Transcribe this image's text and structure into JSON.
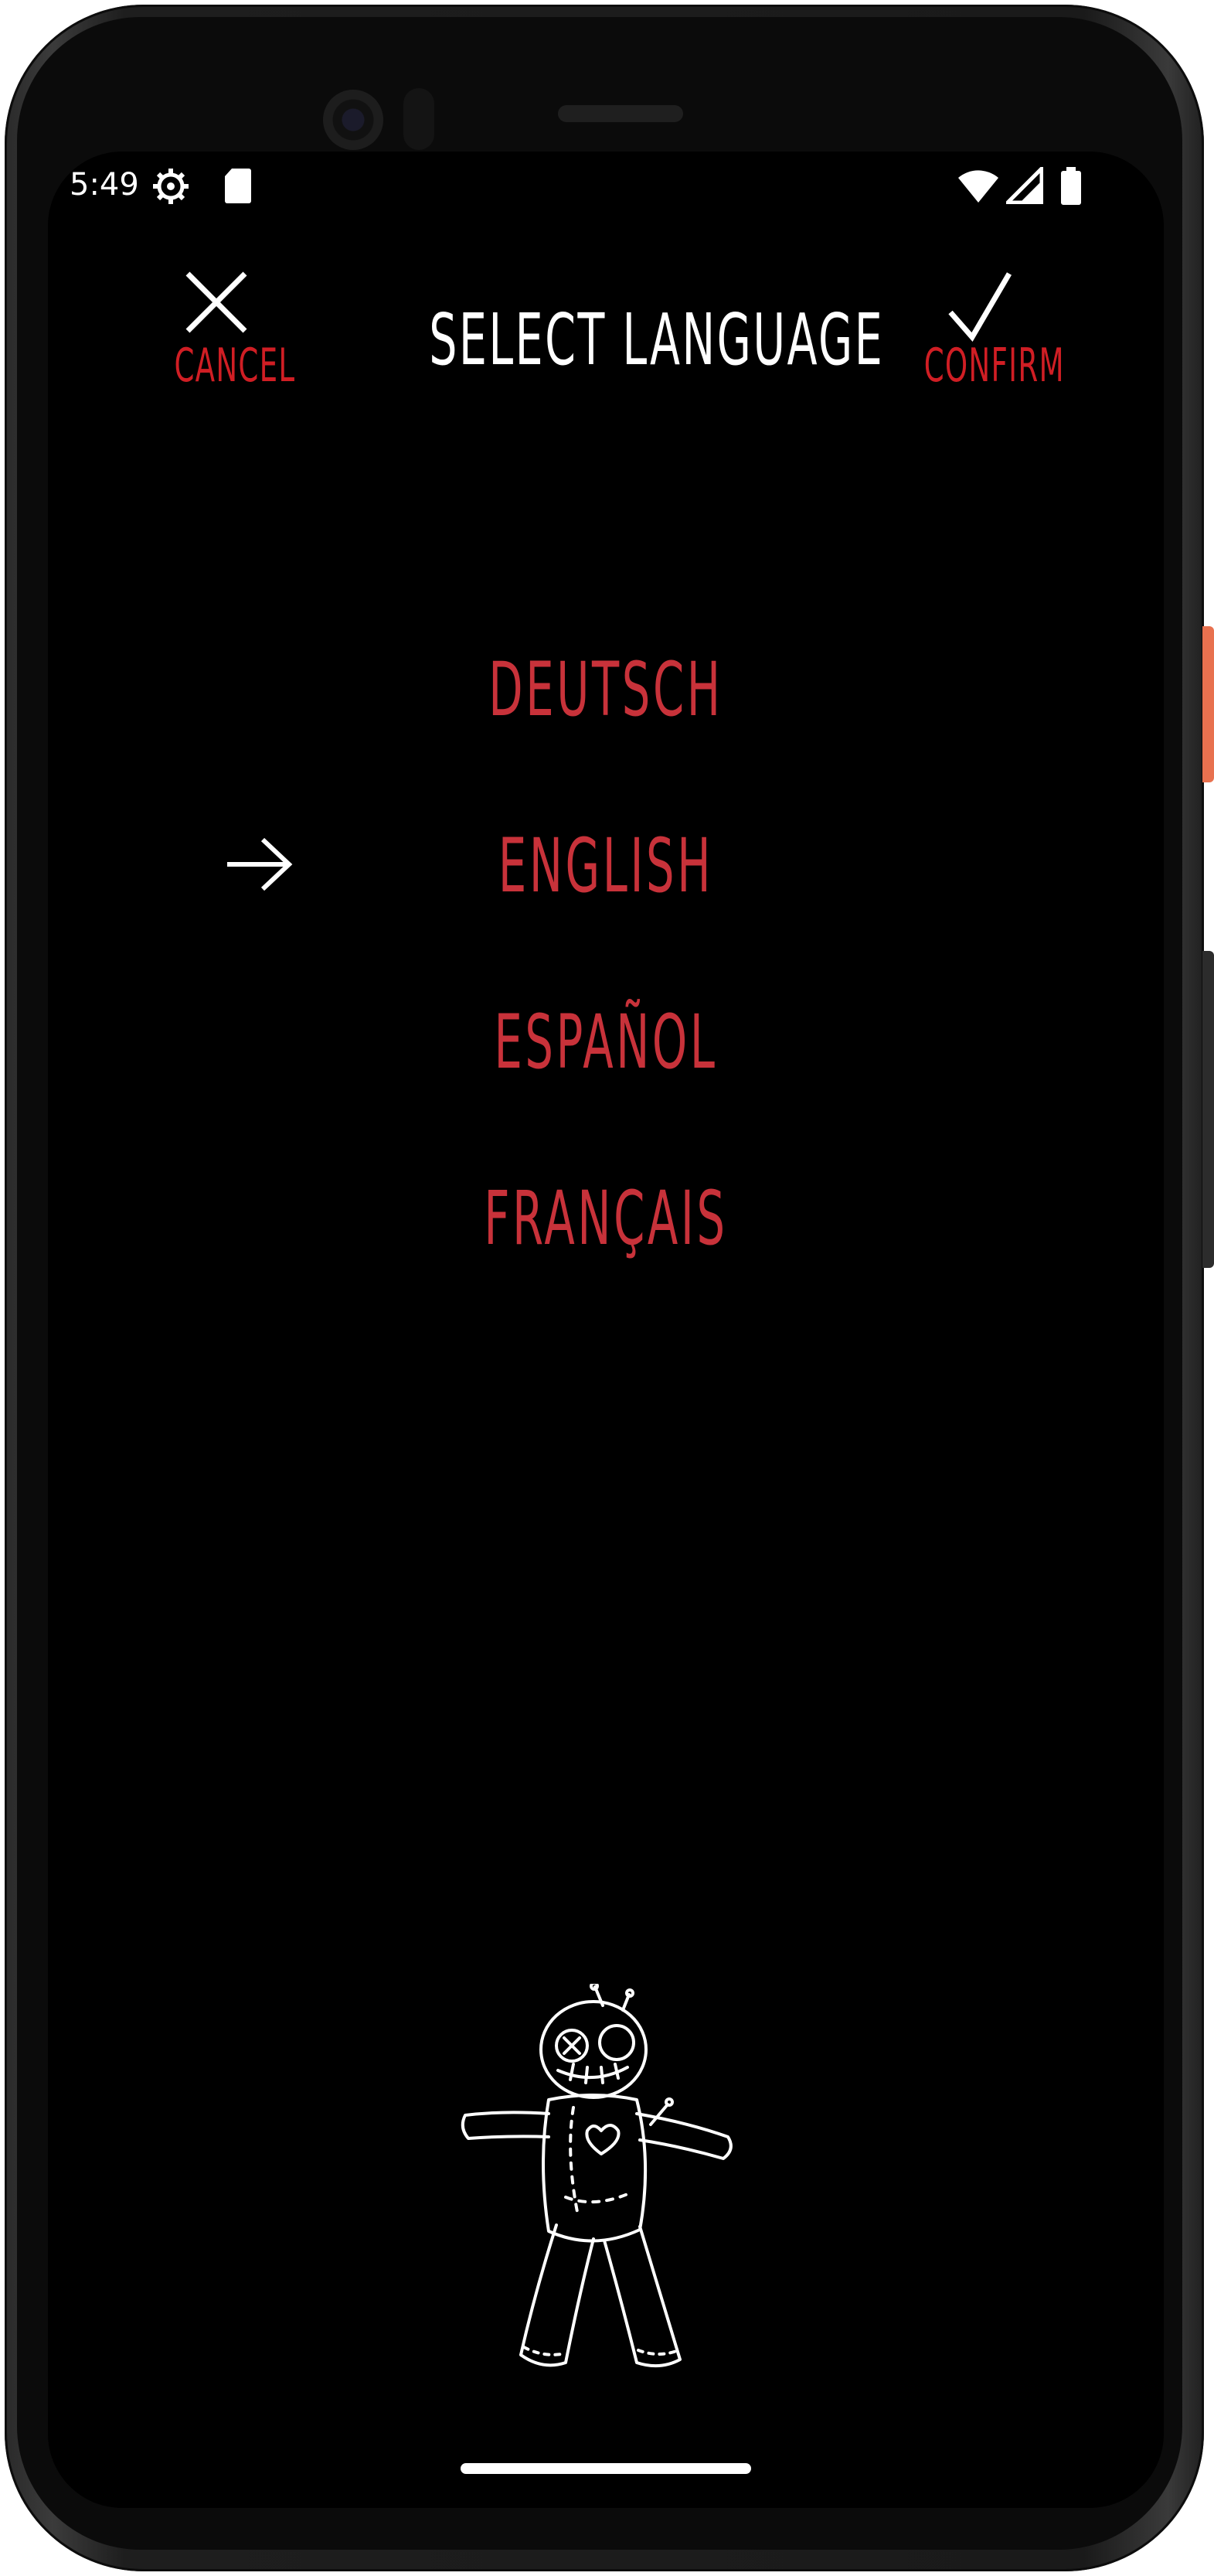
{
  "status_bar": {
    "time": "5:49",
    "icons": [
      "settings-gear-icon",
      "sd-card-icon",
      "wifi-icon",
      "cell-signal-icon",
      "battery-icon"
    ]
  },
  "header": {
    "title": "SELECT LANGUAGE",
    "cancel_label": "CANCEL",
    "cancel_icon": "close-icon",
    "confirm_label": "CONFIRM",
    "confirm_icon": "checkmark-icon"
  },
  "languages": {
    "items": [
      {
        "label": "DEUTSCH",
        "selected": false
      },
      {
        "label": "ENGLISH",
        "selected": true
      },
      {
        "label": "ESPAÑOL",
        "selected": false
      },
      {
        "label": "FRANÇAIS",
        "selected": false
      }
    ],
    "selection_indicator_icon": "arrow-right-icon"
  },
  "illustration": {
    "name": "voodoo-doll-illustration"
  },
  "colors": {
    "background": "#000000",
    "accent_red": "#d01e24",
    "language_red": "#c8323a",
    "title_white": "#ffffff"
  }
}
